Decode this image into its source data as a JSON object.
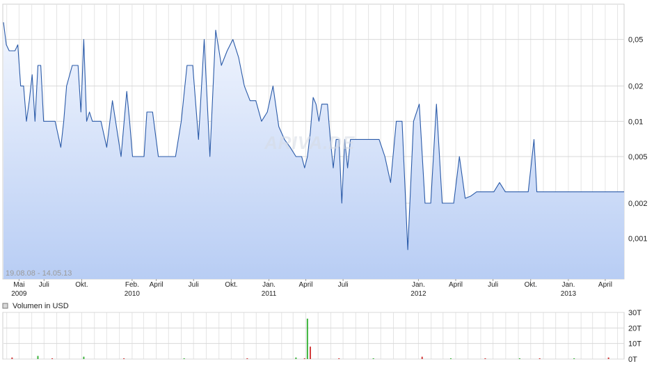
{
  "chart_data": [
    {
      "type": "area",
      "scale": "log",
      "date_range": "19.08.08 - 14.05.13",
      "watermark": "ARIVA.DE",
      "colors": {
        "line": "#2a5aa8",
        "fill_top": "#eef3fd",
        "fill_bottom": "#b8cdf4",
        "grid": "#d8d8d8"
      },
      "y_ticks": [
        "0,05",
        "0,02",
        "0,01",
        "0,005",
        "0,002",
        "0,001"
      ],
      "y_tick_values": [
        0.05,
        0.02,
        0.01,
        0.005,
        0.002,
        0.001
      ],
      "ylim": [
        0.00045,
        0.1
      ],
      "x_ticks": [
        {
          "label": "Mai",
          "year": "2009",
          "date": "2009-05-01"
        },
        {
          "label": "Juli",
          "year": "",
          "date": "2009-07-01"
        },
        {
          "label": "Okt.",
          "year": "",
          "date": "2009-10-01"
        },
        {
          "label": "Feb.",
          "year": "2010",
          "date": "2010-02-01"
        },
        {
          "label": "April",
          "year": "",
          "date": "2010-04-01"
        },
        {
          "label": "Juli",
          "year": "",
          "date": "2010-07-01"
        },
        {
          "label": "Okt.",
          "year": "",
          "date": "2010-10-01"
        },
        {
          "label": "Jan.",
          "year": "2011",
          "date": "2011-01-01"
        },
        {
          "label": "April",
          "year": "",
          "date": "2011-04-01"
        },
        {
          "label": "Juli",
          "year": "",
          "date": "2011-07-01"
        },
        {
          "label": "Jan.",
          "year": "2012",
          "date": "2012-01-01"
        },
        {
          "label": "April",
          "year": "",
          "date": "2012-04-01"
        },
        {
          "label": "Juli",
          "year": "",
          "date": "2012-07-01"
        },
        {
          "label": "Okt.",
          "year": "",
          "date": "2012-10-01"
        },
        {
          "label": "Jan.",
          "year": "2013",
          "date": "2013-01-01"
        },
        {
          "label": "April",
          "year": "",
          "date": "2013-04-01"
        }
      ],
      "x": [
        "2009-03-24",
        "2009-03-31",
        "2009-04-07",
        "2009-04-21",
        "2009-04-28",
        "2009-05-05",
        "2009-05-12",
        "2009-05-19",
        "2009-05-26",
        "2009-06-02",
        "2009-06-09",
        "2009-06-16",
        "2009-06-23",
        "2009-06-30",
        "2009-07-14",
        "2009-07-28",
        "2009-08-11",
        "2009-08-18",
        "2009-08-25",
        "2009-09-08",
        "2009-09-22",
        "2009-09-29",
        "2009-10-06",
        "2009-10-13",
        "2009-10-20",
        "2009-10-27",
        "2009-11-03",
        "2009-11-17",
        "2009-12-01",
        "2009-12-15",
        "2010-01-05",
        "2010-01-19",
        "2010-01-26",
        "2010-02-02",
        "2010-02-09",
        "2010-02-23",
        "2010-03-02",
        "2010-03-09",
        "2010-03-16",
        "2010-03-23",
        "2010-04-06",
        "2010-04-20",
        "2010-05-04",
        "2010-05-18",
        "2010-06-01",
        "2010-06-15",
        "2010-06-29",
        "2010-07-13",
        "2010-07-27",
        "2010-08-10",
        "2010-08-24",
        "2010-09-07",
        "2010-09-21",
        "2010-10-05",
        "2010-10-19",
        "2010-11-02",
        "2010-11-16",
        "2010-11-30",
        "2010-12-14",
        "2010-12-28",
        "2011-01-11",
        "2011-01-25",
        "2011-02-08",
        "2011-02-22",
        "2011-03-08",
        "2011-03-15",
        "2011-03-22",
        "2011-03-29",
        "2011-04-05",
        "2011-04-12",
        "2011-04-19",
        "2011-04-26",
        "2011-05-03",
        "2011-05-10",
        "2011-05-17",
        "2011-05-24",
        "2011-05-31",
        "2011-06-07",
        "2011-06-14",
        "2011-06-21",
        "2011-06-28",
        "2011-07-05",
        "2011-07-12",
        "2011-07-19",
        "2011-08-02",
        "2011-08-16",
        "2011-08-30",
        "2011-09-13",
        "2011-09-27",
        "2011-10-11",
        "2011-10-25",
        "2011-11-08",
        "2011-11-22",
        "2011-12-06",
        "2011-12-20",
        "2012-01-03",
        "2012-01-17",
        "2012-01-31",
        "2012-02-14",
        "2012-02-28",
        "2012-03-13",
        "2012-03-27",
        "2012-04-10",
        "2012-04-24",
        "2012-05-08",
        "2012-05-22",
        "2012-06-05",
        "2012-06-19",
        "2012-07-03",
        "2012-07-17",
        "2012-07-31",
        "2012-08-14",
        "2012-08-28",
        "2012-09-11",
        "2012-09-25",
        "2012-10-09",
        "2012-10-16",
        "2012-10-23",
        "2012-10-30",
        "2012-11-06",
        "2012-11-13",
        "2012-11-20",
        "2012-11-27",
        "2012-12-11",
        "2012-12-25",
        "2013-01-08",
        "2013-01-22",
        "2013-02-05",
        "2013-02-19",
        "2013-03-05",
        "2013-03-19",
        "2013-04-02",
        "2013-04-16",
        "2013-04-30",
        "2013-05-07",
        "2013-05-14"
      ],
      "y": [
        0.07,
        0.045,
        0.04,
        0.04,
        0.045,
        0.02,
        0.02,
        0.01,
        0.015,
        0.025,
        0.01,
        0.03,
        0.03,
        0.01,
        0.01,
        0.01,
        0.006,
        0.01,
        0.02,
        0.03,
        0.03,
        0.012,
        0.05,
        0.01,
        0.012,
        0.01,
        0.01,
        0.01,
        0.006,
        0.015,
        0.005,
        0.018,
        0.01,
        0.005,
        0.005,
        0.005,
        0.005,
        0.012,
        0.012,
        0.012,
        0.005,
        0.005,
        0.005,
        0.005,
        0.01,
        0.03,
        0.03,
        0.007,
        0.05,
        0.005,
        0.06,
        0.03,
        0.04,
        0.05,
        0.035,
        0.02,
        0.015,
        0.015,
        0.01,
        0.012,
        0.02,
        0.009,
        0.007,
        0.006,
        0.005,
        0.005,
        0.005,
        0.004,
        0.005,
        0.008,
        0.016,
        0.014,
        0.01,
        0.014,
        0.014,
        0.014,
        0.007,
        0.004,
        0.007,
        0.007,
        0.002,
        0.007,
        0.004,
        0.007,
        0.007,
        0.007,
        0.007,
        0.007,
        0.007,
        0.005,
        0.003,
        0.01,
        0.01,
        0.0008,
        0.01,
        0.014,
        0.002,
        0.002,
        0.014,
        0.002,
        0.002,
        0.002,
        0.005,
        0.0022,
        0.0023,
        0.0025,
        0.0025,
        0.0025,
        0.0025,
        0.003,
        0.0025,
        0.0025,
        0.0025,
        0.0025,
        0.0025,
        0.007,
        0.0025,
        0.0025,
        0.0025,
        0.0025,
        0.0025,
        0.0025,
        0.0025,
        0.0025,
        0.0025,
        0.0025,
        0.0025,
        0.0025,
        0.0025,
        0.0025,
        0.0025,
        0.0025,
        0.0025,
        0.0025,
        0.0025,
        0.0025
      ],
      "x_trim_note": ""
    },
    {
      "type": "bar",
      "title": "Volumen in USD",
      "y_ticks": [
        "30T",
        "20T",
        "10T",
        "0T"
      ],
      "y_tick_values": [
        30,
        20,
        10,
        0
      ],
      "ylim": [
        0,
        30
      ],
      "colors": {
        "up": "#3cb43c",
        "down": "#d23c3c"
      },
      "x": [
        "2009-04-14",
        "2009-06-16",
        "2009-07-21",
        "2009-10-06",
        "2010-01-12",
        "2010-06-08",
        "2010-11-09",
        "2011-03-08",
        "2011-03-29",
        "2011-04-05",
        "2011-04-12",
        "2011-06-21",
        "2011-09-13",
        "2012-01-10",
        "2012-03-20",
        "2012-06-12",
        "2012-09-04",
        "2012-10-23",
        "2013-01-15",
        "2013-04-09"
      ],
      "values": [
        1,
        2,
        0.5,
        1.5,
        0.5,
        0.5,
        0.5,
        1,
        0.5,
        26,
        8,
        0.5,
        0.5,
        1.5,
        0.5,
        0.5,
        0.5,
        0.5,
        0.5,
        1
      ],
      "directions": [
        "down",
        "up",
        "down",
        "up",
        "down",
        "up",
        "down",
        "up",
        "down",
        "up",
        "down",
        "down",
        "up",
        "down",
        "up",
        "down",
        "up",
        "down",
        "up",
        "down"
      ]
    }
  ]
}
